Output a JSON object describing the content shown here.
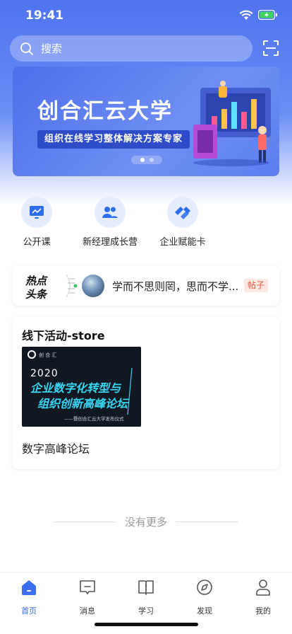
{
  "status_bar": {
    "time": "19:41"
  },
  "search": {
    "placeholder": "搜索"
  },
  "banner": {
    "title": "创合汇云大学",
    "subtitle": "组织在线学习整体解决方案专家",
    "active_slide": 1,
    "slide_count": 2
  },
  "entries": [
    {
      "label": "公开课",
      "icon": "chart-icon"
    },
    {
      "label": "新经理成长营",
      "icon": "people-icon"
    },
    {
      "label": "企业赋能卡",
      "icon": "card-icon"
    }
  ],
  "hot_news": {
    "logo_line1": "热点",
    "logo_line2": "头条",
    "text": "学而不思则罔，思而不学...",
    "tag": "帖子"
  },
  "activity": {
    "title": "线下活动-store",
    "poster": {
      "brand": "创 合 汇",
      "year": "2020",
      "line1": "企业数字化转型与",
      "line2": "组织创新高峰论坛",
      "line3": "——暨创合汇云大学发布仪式"
    },
    "caption": "数字高峰论坛"
  },
  "no_more": "没有更多",
  "tabbar": [
    {
      "label": "首页",
      "icon": "home-icon",
      "active": true
    },
    {
      "label": "消息",
      "icon": "message-icon",
      "active": false
    },
    {
      "label": "学习",
      "icon": "book-icon",
      "active": false
    },
    {
      "label": "发现",
      "icon": "compass-icon",
      "active": false
    },
    {
      "label": "我的",
      "icon": "user-icon",
      "active": false
    }
  ],
  "colors": {
    "primary": "#3b6ff0",
    "banner": "#5a7cf0",
    "tag_text": "#e2553b"
  }
}
